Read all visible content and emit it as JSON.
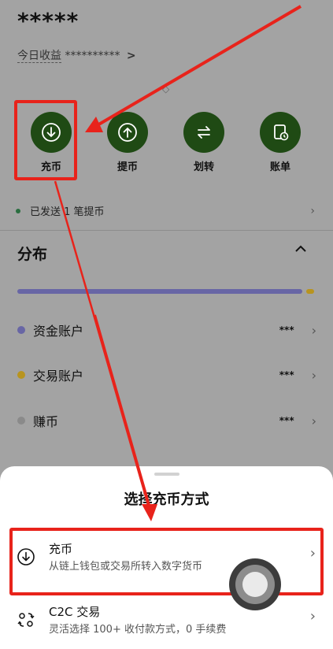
{
  "account": {
    "balance_masked": "*****",
    "today_earnings_label": "今日收益",
    "today_earnings_value": "**********",
    "chevron": ">"
  },
  "actions": [
    {
      "label": "充币",
      "icon": "deposit-icon"
    },
    {
      "label": "提币",
      "icon": "withdraw-icon"
    },
    {
      "label": "划转",
      "icon": "transfer-icon"
    },
    {
      "label": "账单",
      "icon": "bill-icon"
    }
  ],
  "notice": {
    "text": "已发送 1 笔提币",
    "chevron": "›"
  },
  "distribution": {
    "title": "分布",
    "accounts": [
      {
        "name": "资金账户",
        "value": "***",
        "color": "#6866a5"
      },
      {
        "name": "交易账户",
        "value": "***",
        "color": "#b8941f"
      },
      {
        "name": "赚币",
        "value": "***",
        "color": "#8a8a8a"
      }
    ]
  },
  "sheet": {
    "title": "选择充币方式",
    "options": [
      {
        "title": "充币",
        "desc": "从链上钱包或交易所转入数字货币",
        "icon": "deposit-icon"
      },
      {
        "title": "C2C 交易",
        "desc": "灵活选择 100+ 收付款方式，0 手续费",
        "icon": "c2c-icon"
      }
    ],
    "chevron": "›"
  },
  "colors": {
    "action_bg": "#1f4a14",
    "highlight": "#e8231b"
  }
}
